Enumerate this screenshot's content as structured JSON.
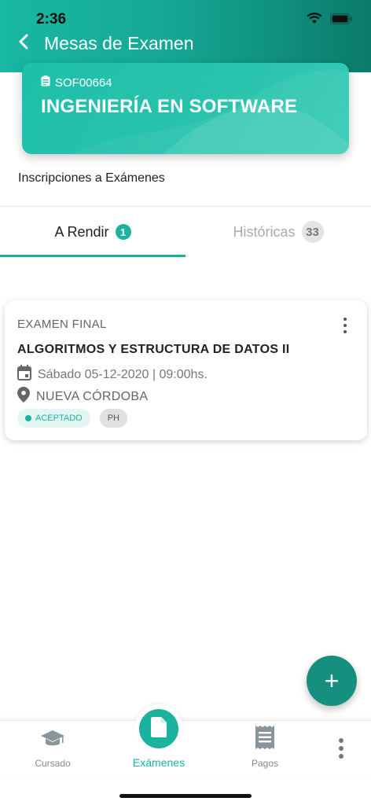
{
  "status_bar": {
    "time": "2:36"
  },
  "header": {
    "title": "Mesas de Examen"
  },
  "career": {
    "code": "SOF00664",
    "name": "INGENIERÍA EN SOFTWARE"
  },
  "section": {
    "title": "Inscripciones a Exámenes"
  },
  "tabs": [
    {
      "label": "A Rendir",
      "count": "1",
      "active": true
    },
    {
      "label": "Históricas",
      "count": "33",
      "active": false
    }
  ],
  "exam": {
    "type": "EXAMEN FINAL",
    "subject": "ALGORITMOS Y ESTRUCTURA DE DATOS II",
    "date": "Sábado 05-12-2020 | 09:00hs.",
    "place": "NUEVA CÓRDOBA",
    "status": "ACEPTADO",
    "tag": "PH"
  },
  "fab": {
    "icon": "plus-icon",
    "label": "+"
  },
  "bottom_nav": {
    "items": [
      {
        "label": "Cursado",
        "icon": "graduation-cap-icon"
      },
      {
        "label": "Exámenes",
        "icon": "document-icon",
        "active": true
      },
      {
        "label": "Pagos",
        "icon": "receipt-icon"
      }
    ]
  },
  "colors": {
    "accent": "#1bb39e",
    "header_dark": "#0b7b6b",
    "fab": "#15907f"
  }
}
